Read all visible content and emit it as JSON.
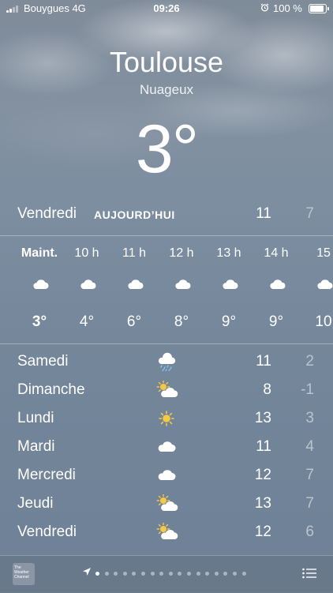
{
  "status_bar": {
    "carrier": "Bouygues",
    "network": "4G",
    "time": "09:26",
    "battery_pct": "100 %",
    "battery_level": 1.0,
    "icons": [
      "signal-icon",
      "alarm-icon",
      "battery-icon"
    ]
  },
  "header": {
    "city": "Toulouse",
    "condition": "Nuageux",
    "temperature": "3°"
  },
  "today": {
    "day": "Vendredi",
    "tag": "AUJOURD’HUI",
    "high": "11",
    "low": "7"
  },
  "hourly": [
    {
      "label": "Maint.",
      "icon": "cloud-icon",
      "temp": "3°",
      "now": true
    },
    {
      "label": "10 h",
      "icon": "cloud-icon",
      "temp": "4°"
    },
    {
      "label": "11 h",
      "icon": "cloud-icon",
      "temp": "6°"
    },
    {
      "label": "12 h",
      "icon": "cloud-icon",
      "temp": "8°"
    },
    {
      "label": "13 h",
      "icon": "cloud-icon",
      "temp": "9°"
    },
    {
      "label": "14 h",
      "icon": "cloud-icon",
      "temp": "9°"
    },
    {
      "label": "15",
      "icon": "cloud-icon",
      "temp": "10"
    }
  ],
  "daily": [
    {
      "day": "Samedi",
      "icon": "rain-cloud-icon",
      "high": "11",
      "low": "2"
    },
    {
      "day": "Dimanche",
      "icon": "sun-cloud-icon",
      "high": "8",
      "low": "-1"
    },
    {
      "day": "Lundi",
      "icon": "sun-icon",
      "high": "13",
      "low": "3"
    },
    {
      "day": "Mardi",
      "icon": "cloud-icon",
      "high": "11",
      "low": "4"
    },
    {
      "day": "Mercredi",
      "icon": "cloud-icon",
      "high": "12",
      "low": "7"
    },
    {
      "day": "Jeudi",
      "icon": "sun-cloud-icon",
      "high": "13",
      "low": "7"
    },
    {
      "day": "Vendredi",
      "icon": "sun-cloud-icon",
      "high": "12",
      "low": "6"
    }
  ],
  "bottom_bar": {
    "provider_logo_text": "The Weather Channel",
    "page_dots": 17,
    "active_dot": 0,
    "icons": [
      "location-arrow-icon",
      "list-icon"
    ]
  },
  "colors": {
    "sun": "#f6c945",
    "rain": "#7cc4f2",
    "low_temp": "#b9c4d0"
  }
}
